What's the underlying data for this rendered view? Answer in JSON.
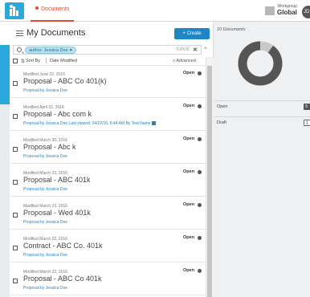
{
  "header": {
    "tab_label": "Documents",
    "workgroup_caption": "Workgroup",
    "workgroup_name": "Global",
    "avatar_initials": "JD"
  },
  "panel": {
    "title": "My Documents",
    "create_label": "+ Create",
    "search": {
      "chip": "author: Jessica Doe",
      "save_label": "SAVE"
    },
    "sort": {
      "sort_by_label": "Sort By",
      "sort_field": "Date Modified",
      "advanced_label": "Advanced"
    },
    "documents": [
      {
        "modified": "Modified June 23, 2016",
        "title": "Proposal - ABC Co 401(k)",
        "by": "Proposal by Jessica Doe",
        "status": "Open"
      },
      {
        "modified": "Modified April 22, 2016",
        "title": "Proposal - Abc com k",
        "by": "Proposal by Jessica Doe Last viewed: 04/22/16, 8:44 AM By Test Name",
        "status": "Open"
      },
      {
        "modified": "Modified March 30, 2016",
        "title": "Proposal - Abc k",
        "by": "Proposal by Jessica Doe",
        "status": "Open"
      },
      {
        "modified": "Modified March 23, 2016",
        "title": "Proposal - ABC 401k",
        "by": "Proposal by Jessica Doe",
        "status": "Open"
      },
      {
        "modified": "Modified March 23, 2016",
        "title": "Proposal - Wed 401k",
        "by": "Proposal by Jessica Doe",
        "status": "Open"
      },
      {
        "modified": "Modified March 22, 2016",
        "title": "Contract - ABC Co. 401k",
        "by": "Proposal by Jessica Doe",
        "status": "Open"
      },
      {
        "modified": "Modified March 22, 2016",
        "title": "Proposal - ABC Co 401k",
        "by": "Proposal by Jessica Doe",
        "status": "Open"
      }
    ]
  },
  "summary": {
    "count_label": "10 Documents",
    "rows": [
      {
        "label": "Open",
        "count": "9"
      },
      {
        "label": "Draft",
        "count": "1"
      }
    ],
    "donut_colors": {
      "open": "#555555",
      "draft": "#c8c8c8"
    },
    "open_fraction": 0.9
  },
  "colors": {
    "accent": "#1f86c6",
    "tab": "#e24a31",
    "left_accent": "#29a9de"
  }
}
